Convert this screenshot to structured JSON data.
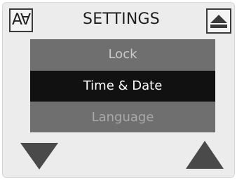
{
  "header": {
    "title": "SETTINGS",
    "font_button_glyph": "A∀",
    "font_button_icon": "font-size-icon",
    "eject_icon": "eject-icon"
  },
  "menu": {
    "items": [
      {
        "label": "Lock",
        "selected": false
      },
      {
        "label": "Time & Date",
        "selected": true
      },
      {
        "label": "Language",
        "selected": false
      }
    ]
  },
  "navigation": {
    "down_icon": "triangle-down-icon",
    "up_icon": "triangle-up-icon"
  },
  "colors": {
    "background": "#ececec",
    "menu_bg": "#6f6f6f",
    "selected_bg": "#111111",
    "selected_text": "#ffffff",
    "arrow": "#4a4a4a"
  }
}
